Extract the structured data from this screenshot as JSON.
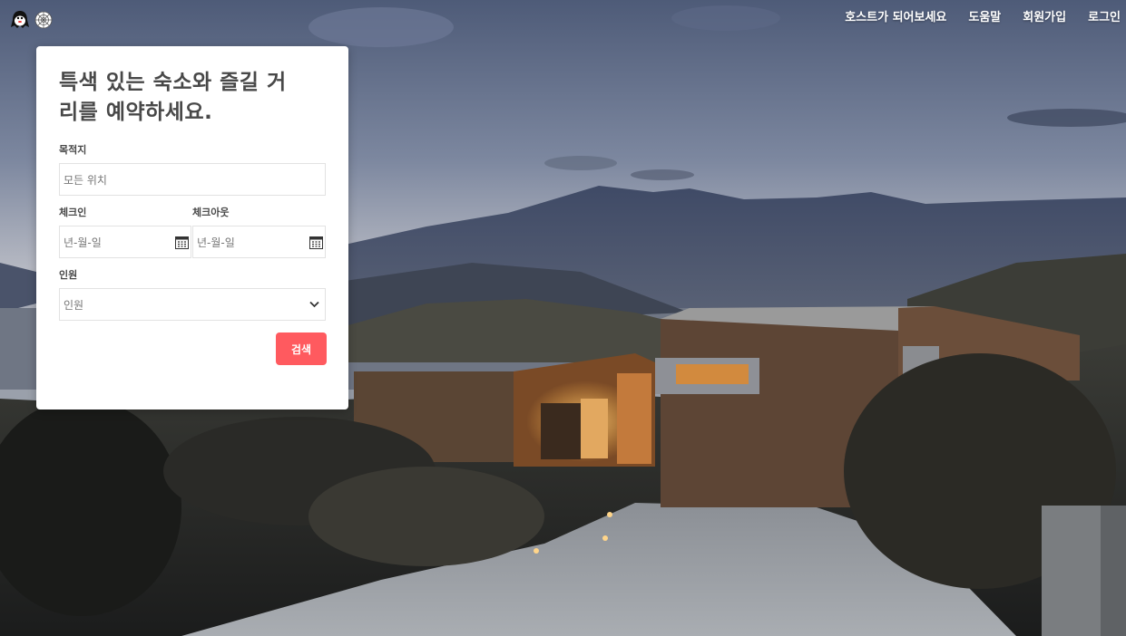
{
  "header": {
    "nav": [
      {
        "label": "호스트가 되어보세요"
      },
      {
        "label": "도움말"
      },
      {
        "label": "회원가입"
      },
      {
        "label": "로그인"
      }
    ]
  },
  "search": {
    "headline": "특색 있는 숙소와 즐길 거리를 예약하세요.",
    "destination": {
      "label": "목적지",
      "placeholder": "모든 위치"
    },
    "checkin": {
      "label": "체크인",
      "placeholder": "년-월-일"
    },
    "checkout": {
      "label": "체크아웃",
      "placeholder": "년-월-일"
    },
    "guests": {
      "label": "인원",
      "selected": "인원"
    },
    "submit_label": "검색"
  },
  "icons": [
    "ghost-logo-icon",
    "spiderweb-logo-icon",
    "calendar-icon",
    "chevron-down-icon"
  ],
  "colors": {
    "accent": "#ff5a5f",
    "heading": "#484848",
    "input_border": "#e2e2e2"
  }
}
